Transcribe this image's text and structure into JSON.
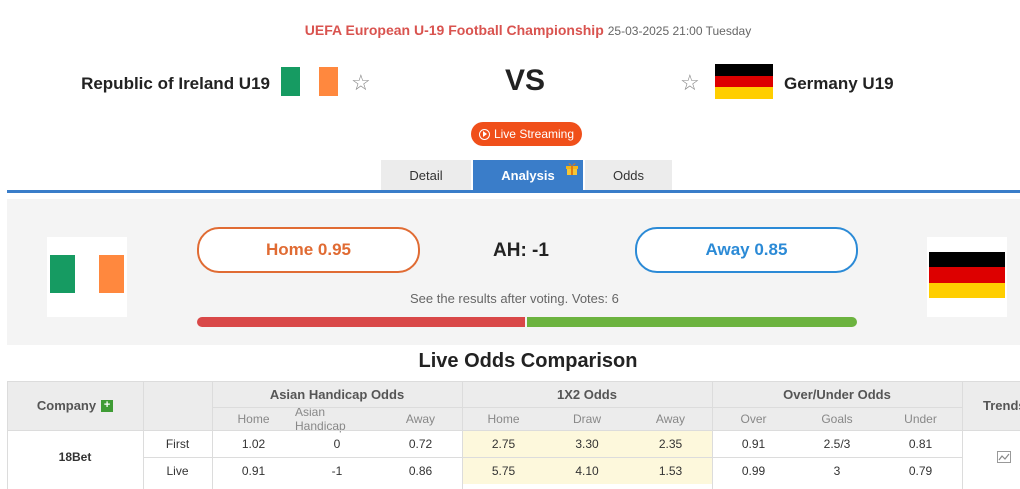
{
  "header": {
    "competition": "UEFA European U-19 Football Championship",
    "datetime": "25-03-2025 21:00 Tuesday",
    "home_team": "Republic of Ireland U19",
    "away_team": "Germany U19",
    "vs": "VS",
    "live_label": "Live Streaming"
  },
  "tabs": [
    {
      "label": "Detail"
    },
    {
      "label": "Analysis"
    },
    {
      "label": "Odds"
    }
  ],
  "vote": {
    "home_label": "Home 0.95",
    "away_label": "Away 0.85",
    "handicap": "AH: -1",
    "note": "See the results after voting. Votes: 6",
    "home_share": 0.5,
    "away_share": 0.5
  },
  "odds": {
    "title": "Live Odds Comparison",
    "company_header": "Company",
    "groups": [
      "Asian Handicap Odds",
      "1X2 Odds",
      "Over/Under Odds"
    ],
    "trends_header": "Trends",
    "subheaders": [
      "Home",
      "Asian Handicap",
      "Away",
      "Home",
      "Draw",
      "Away",
      "Over",
      "Goals",
      "Under"
    ],
    "company": "18Bet",
    "rows": [
      {
        "type": "First",
        "ah_home": "1.02",
        "ah_line": "0",
        "ah_away": "0.72",
        "x_home": "2.75",
        "x_draw": "3.30",
        "x_away": "2.35",
        "ou_over": "0.91",
        "ou_goals": "2.5/3",
        "ou_under": "0.81"
      },
      {
        "type": "Live",
        "ah_home": "0.91",
        "ah_line": "-1",
        "ah_away": "0.86",
        "x_home": "5.75",
        "x_draw": "4.10",
        "x_away": "1.53",
        "ou_over": "0.99",
        "ou_goals": "3",
        "ou_under": "0.79"
      }
    ]
  },
  "colors": {
    "ireland_green": "#169b62",
    "ireland_orange": "#ff883e",
    "germany_black": "#000000",
    "germany_red": "#dd0000",
    "germany_gold": "#ffce00",
    "accent_blue": "#3a7dc9",
    "live_orange": "#f04f1a"
  }
}
